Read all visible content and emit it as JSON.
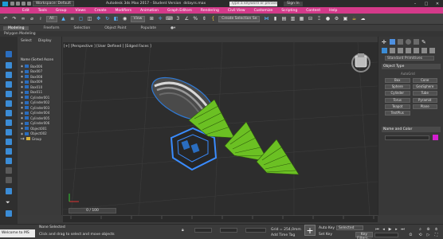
{
  "titlebar": {
    "workspace": "Workspace: Default",
    "app_title": "Autodesk 3ds Max 2017 - Student Version",
    "file_name": "dstayrs.max",
    "search_placeholder": "Type a keyword or phrase",
    "sign_in": "Sign In"
  },
  "menu": [
    "Edit",
    "Tools",
    "Group",
    "Views",
    "Create",
    "Modifiers",
    "Animation",
    "Graph Editors",
    "Rendering",
    "Civil View",
    "Customize",
    "Scripting",
    "Content",
    "Help"
  ],
  "toolbar": {
    "filter": "All",
    "selection_set": "Create Selection Se"
  },
  "ribbon": {
    "tabs": [
      "Modeling",
      "Freeform",
      "Selection",
      "Object Paint",
      "Populate"
    ],
    "panel_label": "Polygon Modeling"
  },
  "explorer": {
    "tabs": [
      "Select",
      "Display"
    ],
    "header": "Name (Sorted Ascen",
    "items": [
      "Box006",
      "Box007",
      "Box008",
      "Box009",
      "Box010",
      "Box011",
      "Cylinder001",
      "Cylinder002",
      "Cylinder003",
      "Cylinder004",
      "Cylinder005",
      "Cylinder006",
      "Object001",
      "Object002",
      "Group"
    ]
  },
  "viewport": {
    "label": "[+] [Perspective ] [User Defined ] [Edged Faces ]"
  },
  "command_panel": {
    "dropdown": "Standard Primitives",
    "object_type_title": "Object Type",
    "autogrid": "AutoGrid",
    "buttons": [
      "Box",
      "Cone",
      "Sphere",
      "GeoSphere",
      "Cylinder",
      "Tube",
      "Torus",
      "Pyramid",
      "Teapot",
      "Plane",
      "TextPlus"
    ],
    "name_color_title": "Name and Color",
    "accent": "#d41fd0"
  },
  "timeline": {
    "frame_label": "0 / 100"
  },
  "status": {
    "welcome": "Welcome to MS",
    "line1": "None Selected",
    "line2": "Click and drag to select and move objects",
    "grid": "Grid = 254,0mm",
    "add_time_tag": "Add Time Tag",
    "auto_key": "Auto Key",
    "set_key": "Set Key",
    "selected": "Selected",
    "key_filters": "Key Filters..."
  }
}
